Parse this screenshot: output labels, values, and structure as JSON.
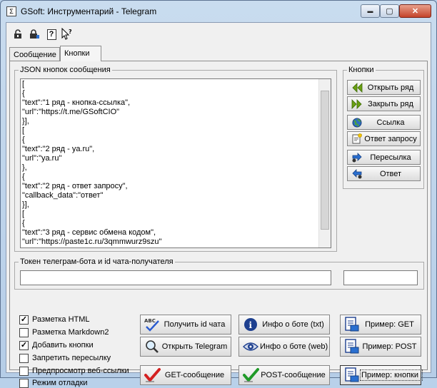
{
  "window": {
    "title": "GSoft: Инструментарий - Telegram",
    "app_icon_glyph": "Σ",
    "minimize_glyph": "▬",
    "maximize_glyph": "▢",
    "close_glyph": "✕"
  },
  "toolbar": {
    "icons": [
      "lock-open-icon",
      "lock-save-icon",
      "help-icon",
      "whats-this-pointer-icon"
    ],
    "help_glyph": "?"
  },
  "tabs": [
    {
      "label": "Сообщение",
      "active": false
    },
    {
      "label": "Кнопки",
      "active": true
    }
  ],
  "json_group": {
    "legend": "JSON кнопок сообщения",
    "content": "[\n{\n\"text\":\"1 ряд - кнопка-ссылка\",\n\"url\":\"https://t.me/GSoftCIO\"\n}],\n[\n{\n\"text\":\"2 ряд - ya.ru\",\n\"url\":\"ya.ru\"\n},\n{\n\"text\":\"2 ряд - ответ запросу\",\n\"callback_data\":\"ответ\"\n}],\n[\n{\n\"text\":\"3 ряд - сервис обмена кодом\",\n\"url\":\"https://paste1c.ru/3qmmwurz9szu\""
  },
  "buttons_group": {
    "legend": "Кнопки",
    "items": [
      {
        "label": "Открыть ряд",
        "icon": "double-chevron-left-icon"
      },
      {
        "label": "Закрыть ряд",
        "icon": "double-chevron-right-icon"
      },
      {
        "label": "Ссылка",
        "icon": "globe-icon"
      },
      {
        "label": "Ответ запросу",
        "icon": "add-document-icon"
      },
      {
        "label": "Пересылка",
        "icon": "forward-icon"
      },
      {
        "label": "Ответ",
        "icon": "reply-icon"
      }
    ]
  },
  "token_group": {
    "legend": "Токен телеграм-бота и id чата-получателя",
    "token_value": "",
    "chat_id_value": ""
  },
  "options": [
    {
      "label": "Разметка HTML",
      "checked": true
    },
    {
      "label": "Разметка Markdown2",
      "checked": false
    },
    {
      "label": "Добавить кнопки",
      "checked": true
    },
    {
      "label": "Запретить пересылку",
      "checked": false
    },
    {
      "label": "Предпросмотр веб-ссылки",
      "checked": false
    },
    {
      "label": "Режим отладки",
      "checked": false
    }
  ],
  "actions": {
    "get_chat_id": "Получить id чата",
    "open_telegram": "Открыть Telegram",
    "get_message": "GET-сообщение",
    "bot_info_txt": "Инфо о боте (txt)",
    "bot_info_web": "Инфо о боте (web)",
    "post_message": "POST-сообщение",
    "example_get": "Пример: GET",
    "example_post": "Пример: POST",
    "example_buttons": "Пример: кнопки",
    "abc_glyph": "ABC"
  },
  "colors": {
    "accent_green": "#6aa012",
    "check_red": "#d42020",
    "check_green": "#1f9a28",
    "info_blue": "#1d3f8f"
  }
}
